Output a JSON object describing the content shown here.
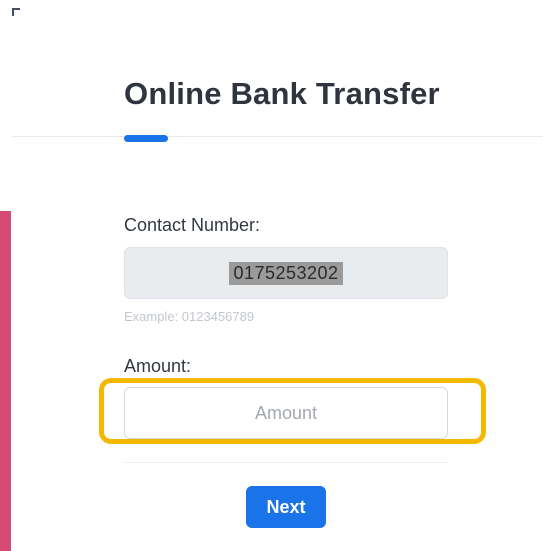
{
  "page": {
    "title": "Online Bank Transfer"
  },
  "form": {
    "contact_label": "Contact Number:",
    "contact_value": "0175253202",
    "contact_hint": "Example: 0123456789",
    "amount_label": "Amount:",
    "amount_placeholder": "Amount",
    "amount_value": "",
    "next_label": "Next"
  },
  "colors": {
    "accent": "#1a73e8",
    "highlight": "#f5b800",
    "side_strip": "#d44a73"
  }
}
